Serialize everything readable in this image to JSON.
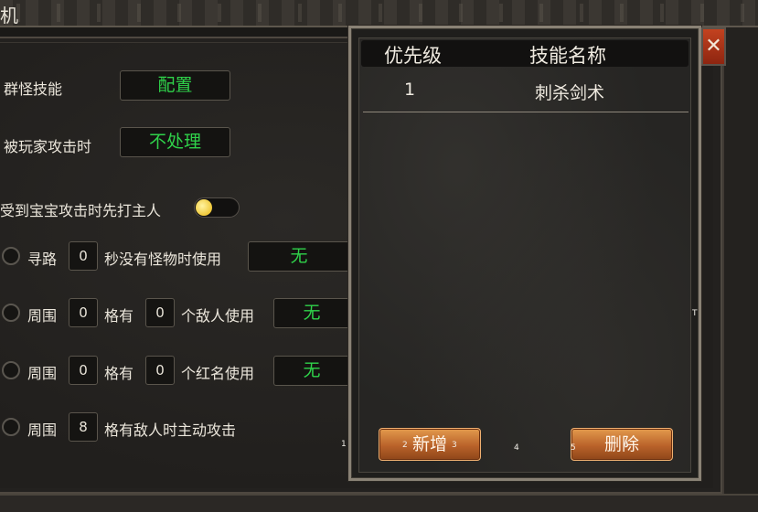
{
  "window": {
    "title": "机"
  },
  "settings": {
    "group_skill": {
      "label": "群怪技能",
      "value": "配置"
    },
    "attacked_by_player": {
      "label": "被玩家攻击时",
      "value": "不处理"
    },
    "pet_attack": {
      "label": "受到宝宝攻击时先打主人",
      "enabled": true
    },
    "rules": [
      {
        "prefix": "寻路",
        "num1": "0",
        "mid": "秒没有怪物时使用",
        "value": "无"
      },
      {
        "prefix": "周围",
        "num1": "0",
        "mid": "格有",
        "num2": "0",
        "suffix": "个敌人使用",
        "value": "无"
      },
      {
        "prefix": "周围",
        "num1": "0",
        "mid": "格有",
        "num2": "0",
        "suffix": "个红名使用",
        "value": "无"
      },
      {
        "prefix": "周围",
        "num1": "8",
        "mid": "格有敌人时主动攻击"
      }
    ]
  },
  "skill_list": {
    "headers": {
      "priority": "优先级",
      "skill_name": "技能名称"
    },
    "rows": [
      {
        "priority": "1",
        "skill_name": "刺杀剑术"
      }
    ],
    "add_label": "新增",
    "delete_label": "删除"
  },
  "close_label": "✕",
  "markers": [
    "1",
    "2",
    "3",
    "4",
    "5",
    "6",
    "T"
  ]
}
